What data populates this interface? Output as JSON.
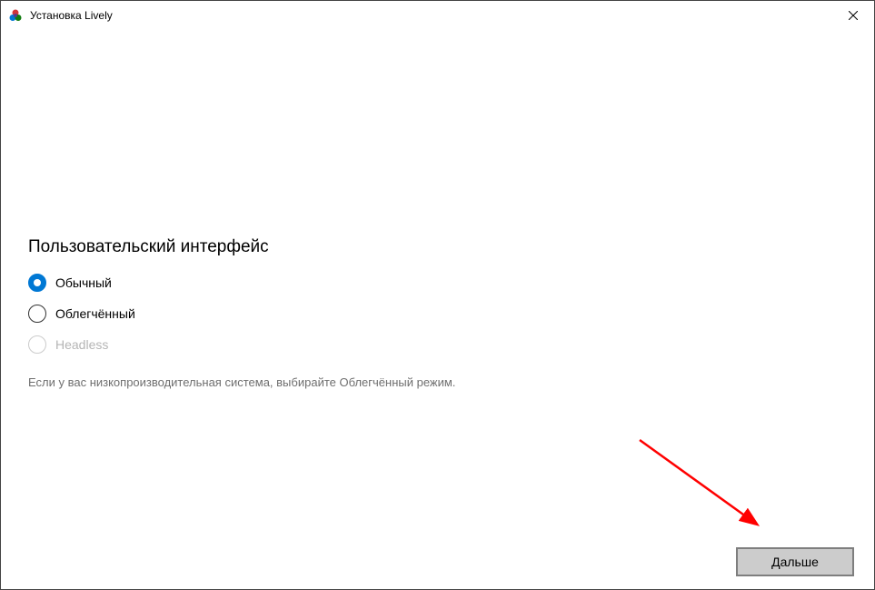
{
  "window": {
    "title": "Установка Lively"
  },
  "section": {
    "heading": "Пользовательский интерфейс",
    "hint": "Если у вас низкопроизводительная система, выбирайте Облегчённый режим."
  },
  "options": {
    "normal": "Обычный",
    "lite": "Облегчённый",
    "headless": "Headless"
  },
  "buttons": {
    "next": "Дальше"
  }
}
